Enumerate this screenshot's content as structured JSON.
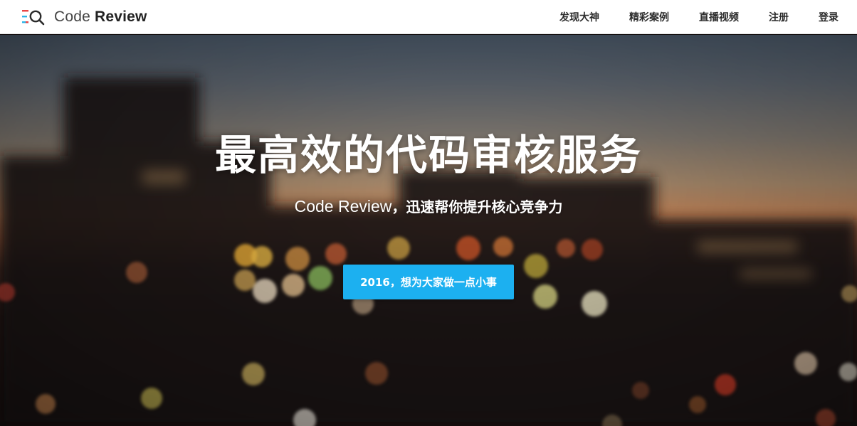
{
  "brand": {
    "name_light": "Code",
    "name_bold": "Review",
    "icon": "magnifier-lines-logo-icon",
    "colors": {
      "line_red": "#e84545",
      "line_blue": "#2bb4e8",
      "text": "#222222"
    }
  },
  "nav": {
    "items": [
      {
        "label": "发现大神"
      },
      {
        "label": "精彩案例"
      },
      {
        "label": "直播视频"
      },
      {
        "label": "注册"
      },
      {
        "label": "登录"
      }
    ]
  },
  "hero": {
    "title": "最高效的代码审核服务",
    "subtitle_en": "Code Review",
    "subtitle_cn": "，迅速帮你提升核心竞争力",
    "cta_label": "2016，想为大家做一点小事",
    "background": "blurred-city-skyline-at-dusk-bokeh",
    "colors": {
      "cta": "#1cb0f0",
      "text": "#ffffff"
    }
  }
}
